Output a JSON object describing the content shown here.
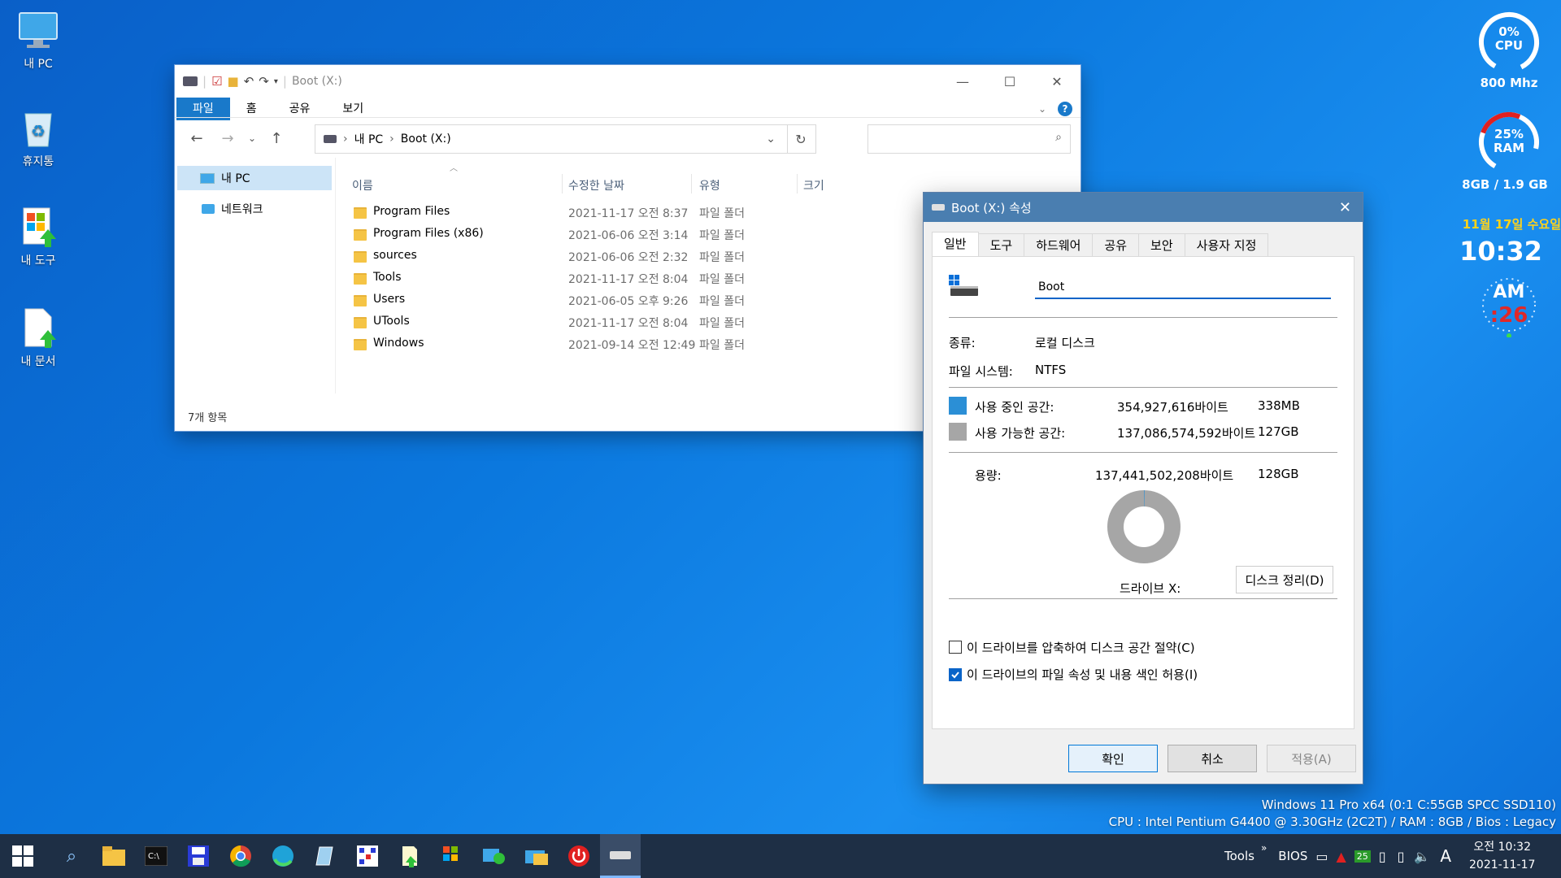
{
  "desktop": {
    "icons": [
      {
        "label": "내 PC",
        "icon": "monitor-icon"
      },
      {
        "label": "휴지통",
        "icon": "recycle-bin-icon"
      },
      {
        "label": "내 도구",
        "icon": "tools-icon"
      },
      {
        "label": "내 문서",
        "icon": "document-icon"
      }
    ]
  },
  "explorer": {
    "title": "Boot (X:)",
    "ribbon_tabs": [
      "파일",
      "홈",
      "공유",
      "보기"
    ],
    "breadcrumb": [
      "내 PC",
      "Boot (X:)"
    ],
    "sidebar": [
      "내 PC",
      "네트워크"
    ],
    "columns": {
      "name": "이름",
      "date": "수정한 날짜",
      "type": "유형",
      "size": "크기"
    },
    "rows": [
      {
        "name": "Program Files",
        "date": "2021-11-17 오전 8:37",
        "type": "파일 폴더"
      },
      {
        "name": "Program Files (x86)",
        "date": "2021-06-06 오전 3:14",
        "type": "파일 폴더"
      },
      {
        "name": "sources",
        "date": "2021-06-06 오전 2:32",
        "type": "파일 폴더"
      },
      {
        "name": "Tools",
        "date": "2021-11-17 오전 8:04",
        "type": "파일 폴더"
      },
      {
        "name": "Users",
        "date": "2021-06-05 오후 9:26",
        "type": "파일 폴더"
      },
      {
        "name": "UTools",
        "date": "2021-11-17 오전 8:04",
        "type": "파일 폴더"
      },
      {
        "name": "Windows",
        "date": "2021-09-14 오전 12:49",
        "type": "파일 폴더"
      }
    ],
    "status": "7개 항목"
  },
  "properties": {
    "title": "Boot (X:) 속성",
    "tabs": [
      "일반",
      "도구",
      "하드웨어",
      "공유",
      "보안",
      "사용자 지정"
    ],
    "name_value": "Boot",
    "type_label": "종류:",
    "type_value": "로컬 디스크",
    "fs_label": "파일 시스템:",
    "fs_value": "NTFS",
    "used_label": "사용 중인 공간:",
    "used_bytes": "354,927,616바이트",
    "used_short": "338MB",
    "free_label": "사용 가능한 공간:",
    "free_bytes": "137,086,574,592바이트",
    "free_short": "127GB",
    "cap_label": "용량:",
    "cap_bytes": "137,441,502,208바이트",
    "cap_short": "128GB",
    "used_fraction": 0.0026,
    "drive_label": "드라이브 X:",
    "cleanup_button": "디스크 정리(D)",
    "compress_label": "이 드라이브를 압축하여 디스크 공간 절약(C)",
    "index_label": "이 드라이브의 파일 속성 및 내용 색인 허용(I)",
    "compress_checked": false,
    "index_checked": true,
    "ok": "확인",
    "cancel": "취소",
    "apply": "적용(A)",
    "colors": {
      "used": "#2b8fd6",
      "free": "#a6a6a6"
    }
  },
  "widgets": {
    "cpu_percent": "0%",
    "cpu_label": "CPU",
    "cpu_freq": "800 Mhz",
    "ram_percent": "25%",
    "ram_label": "RAM",
    "ram_usage": "8GB /  1.9 GB",
    "date_line": "11월 17일 수요일",
    "time": "10:32",
    "ampm": "AM",
    "seconds": ":26"
  },
  "sysinfo": {
    "line1": "Windows 11 Pro x64 (0:1 C:55GB SPCC SSD110)",
    "line2": "CPU : Intel Pentium G4400 @ 3.30GHz (2C2T) / RAM : 8GB / Bios : Legacy"
  },
  "taskbar": {
    "tray_tools": "Tools",
    "tray_bios": "BIOS",
    "tray_badge": "25",
    "ime": "A",
    "clock_time": "오전 10:32",
    "clock_date": "2021-11-17"
  }
}
